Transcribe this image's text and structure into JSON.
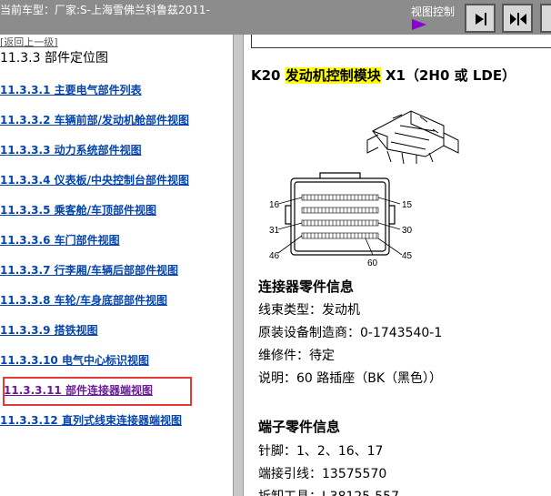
{
  "topbar": {
    "vehicle_label": "当前车型：厂家:S-上海雪佛兰科鲁兹2011-",
    "view_control_label": "视图控制",
    "buttons": [
      "expand-right-icon",
      "split-view-icon",
      "more-icon"
    ]
  },
  "left": {
    "back_link": "[返回上一级]",
    "section_title": "11.3.3  部件定位图",
    "items": [
      "11.3.3.1  主要电气部件列表",
      "11.3.3.2  车辆前部/发动机舱部件视图",
      "11.3.3.3  动力系统部件视图",
      "11.3.3.4  仪表板/中央控制台部件视图",
      "11.3.3.5  乘客舱/车顶部件视图",
      "11.3.3.6  车门部件视图",
      "11.3.3.7  行李厢/车辆后部部件视图",
      "11.3.3.8  车轮/车身底部部件视图",
      "11.3.3.9  搭铁视图",
      "11.3.3.10  电气中心标识视图",
      "11.3.3.11  部件连接器端视图",
      "11.3.3.12  直列式线束连接器端视图"
    ]
  },
  "right": {
    "heading_pre": "K20 ",
    "heading_hl": "发动机控制模块",
    "heading_post": " X1（2H0 或 LDE）",
    "pin_labels": [
      "16",
      "15",
      "31",
      "30",
      "46",
      "60",
      "45"
    ],
    "connector_info_title": "连接器零件信息",
    "connector_info": [
      "线束类型：发动机",
      "原装设备制造商：0-1743540-1",
      "维修件：待定",
      "说明：60 路插座（BK（黑色））"
    ],
    "terminal_info_title": "端子零件信息",
    "terminal_info": [
      "针脚：1、2、16、17",
      "端接引线：13575570",
      "拆卸工具：J-38125-557"
    ]
  }
}
